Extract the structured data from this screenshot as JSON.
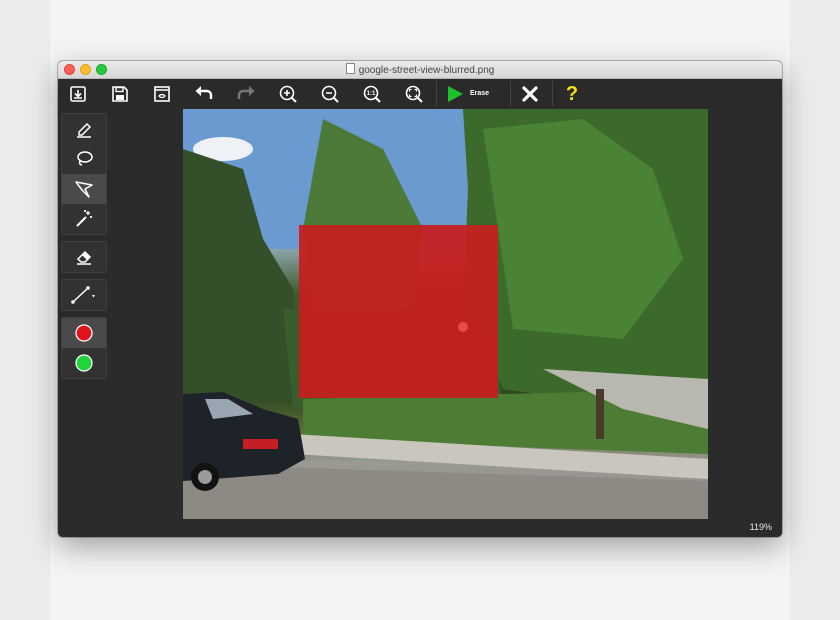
{
  "window": {
    "title": "google-street-view-blurred.png"
  },
  "toolbar": {
    "items": [
      {
        "name": "open-icon"
      },
      {
        "name": "save-icon"
      },
      {
        "name": "view-icon"
      },
      {
        "name": "undo-icon"
      },
      {
        "name": "redo-icon"
      },
      {
        "name": "zoom-in-icon"
      },
      {
        "name": "zoom-out-icon"
      },
      {
        "name": "zoom-actual-icon",
        "text": "1:1"
      },
      {
        "name": "zoom-fit-icon"
      }
    ],
    "erase_label": "Erase",
    "close_icon": "close-icon",
    "help_label": "?"
  },
  "sidebar": {
    "tools": [
      "marker-icon",
      "lasso-icon",
      "polygon-lasso-icon",
      "magic-wand-icon"
    ],
    "eraser": "eraser-icon",
    "line": "line-icon",
    "colors": [
      {
        "name": "red-color",
        "hex": "#e3131b"
      },
      {
        "name": "green-color",
        "hex": "#1ed53c"
      }
    ]
  },
  "colors": {
    "accent_green": "#1cc22e",
    "help_yellow": "#f3e019",
    "mask_red": "#c71e1e"
  },
  "status": {
    "zoom": "119%"
  }
}
